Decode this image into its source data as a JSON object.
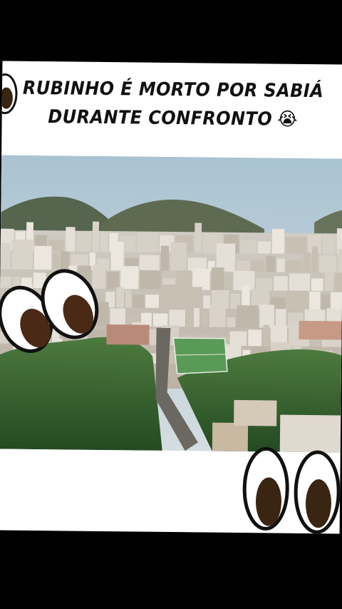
{
  "caption": {
    "line1": "RUBINHO É MORTO POR SABIÁ",
    "line2": "DURANTE CONFRONTO",
    "emoji": "😭"
  },
  "scene": {
    "description_icons": [
      "googly-eyes-icon"
    ],
    "colors": {
      "sky": "#b9cbd6",
      "hills": "#5a6a52",
      "buildings": "#d9d2c6",
      "vegetation": "#3d6a34",
      "pitch": "#5a9a58"
    }
  }
}
